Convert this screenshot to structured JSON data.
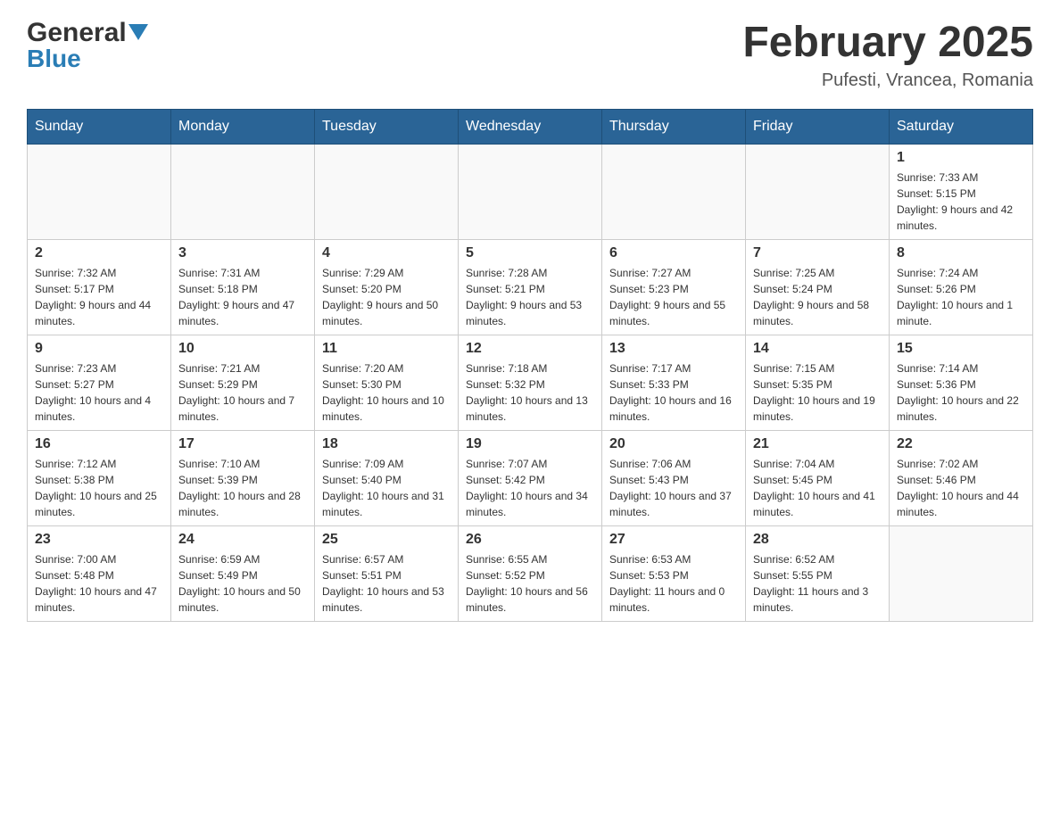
{
  "header": {
    "logo_general": "General",
    "logo_blue": "Blue",
    "month_title": "February 2025",
    "location": "Pufesti, Vrancea, Romania"
  },
  "days_of_week": [
    "Sunday",
    "Monday",
    "Tuesday",
    "Wednesday",
    "Thursday",
    "Friday",
    "Saturday"
  ],
  "weeks": [
    [
      {
        "day": "",
        "info": ""
      },
      {
        "day": "",
        "info": ""
      },
      {
        "day": "",
        "info": ""
      },
      {
        "day": "",
        "info": ""
      },
      {
        "day": "",
        "info": ""
      },
      {
        "day": "",
        "info": ""
      },
      {
        "day": "1",
        "info": "Sunrise: 7:33 AM\nSunset: 5:15 PM\nDaylight: 9 hours and 42 minutes."
      }
    ],
    [
      {
        "day": "2",
        "info": "Sunrise: 7:32 AM\nSunset: 5:17 PM\nDaylight: 9 hours and 44 minutes."
      },
      {
        "day": "3",
        "info": "Sunrise: 7:31 AM\nSunset: 5:18 PM\nDaylight: 9 hours and 47 minutes."
      },
      {
        "day": "4",
        "info": "Sunrise: 7:29 AM\nSunset: 5:20 PM\nDaylight: 9 hours and 50 minutes."
      },
      {
        "day": "5",
        "info": "Sunrise: 7:28 AM\nSunset: 5:21 PM\nDaylight: 9 hours and 53 minutes."
      },
      {
        "day": "6",
        "info": "Sunrise: 7:27 AM\nSunset: 5:23 PM\nDaylight: 9 hours and 55 minutes."
      },
      {
        "day": "7",
        "info": "Sunrise: 7:25 AM\nSunset: 5:24 PM\nDaylight: 9 hours and 58 minutes."
      },
      {
        "day": "8",
        "info": "Sunrise: 7:24 AM\nSunset: 5:26 PM\nDaylight: 10 hours and 1 minute."
      }
    ],
    [
      {
        "day": "9",
        "info": "Sunrise: 7:23 AM\nSunset: 5:27 PM\nDaylight: 10 hours and 4 minutes."
      },
      {
        "day": "10",
        "info": "Sunrise: 7:21 AM\nSunset: 5:29 PM\nDaylight: 10 hours and 7 minutes."
      },
      {
        "day": "11",
        "info": "Sunrise: 7:20 AM\nSunset: 5:30 PM\nDaylight: 10 hours and 10 minutes."
      },
      {
        "day": "12",
        "info": "Sunrise: 7:18 AM\nSunset: 5:32 PM\nDaylight: 10 hours and 13 minutes."
      },
      {
        "day": "13",
        "info": "Sunrise: 7:17 AM\nSunset: 5:33 PM\nDaylight: 10 hours and 16 minutes."
      },
      {
        "day": "14",
        "info": "Sunrise: 7:15 AM\nSunset: 5:35 PM\nDaylight: 10 hours and 19 minutes."
      },
      {
        "day": "15",
        "info": "Sunrise: 7:14 AM\nSunset: 5:36 PM\nDaylight: 10 hours and 22 minutes."
      }
    ],
    [
      {
        "day": "16",
        "info": "Sunrise: 7:12 AM\nSunset: 5:38 PM\nDaylight: 10 hours and 25 minutes."
      },
      {
        "day": "17",
        "info": "Sunrise: 7:10 AM\nSunset: 5:39 PM\nDaylight: 10 hours and 28 minutes."
      },
      {
        "day": "18",
        "info": "Sunrise: 7:09 AM\nSunset: 5:40 PM\nDaylight: 10 hours and 31 minutes."
      },
      {
        "day": "19",
        "info": "Sunrise: 7:07 AM\nSunset: 5:42 PM\nDaylight: 10 hours and 34 minutes."
      },
      {
        "day": "20",
        "info": "Sunrise: 7:06 AM\nSunset: 5:43 PM\nDaylight: 10 hours and 37 minutes."
      },
      {
        "day": "21",
        "info": "Sunrise: 7:04 AM\nSunset: 5:45 PM\nDaylight: 10 hours and 41 minutes."
      },
      {
        "day": "22",
        "info": "Sunrise: 7:02 AM\nSunset: 5:46 PM\nDaylight: 10 hours and 44 minutes."
      }
    ],
    [
      {
        "day": "23",
        "info": "Sunrise: 7:00 AM\nSunset: 5:48 PM\nDaylight: 10 hours and 47 minutes."
      },
      {
        "day": "24",
        "info": "Sunrise: 6:59 AM\nSunset: 5:49 PM\nDaylight: 10 hours and 50 minutes."
      },
      {
        "day": "25",
        "info": "Sunrise: 6:57 AM\nSunset: 5:51 PM\nDaylight: 10 hours and 53 minutes."
      },
      {
        "day": "26",
        "info": "Sunrise: 6:55 AM\nSunset: 5:52 PM\nDaylight: 10 hours and 56 minutes."
      },
      {
        "day": "27",
        "info": "Sunrise: 6:53 AM\nSunset: 5:53 PM\nDaylight: 11 hours and 0 minutes."
      },
      {
        "day": "28",
        "info": "Sunrise: 6:52 AM\nSunset: 5:55 PM\nDaylight: 11 hours and 3 minutes."
      },
      {
        "day": "",
        "info": ""
      }
    ]
  ]
}
